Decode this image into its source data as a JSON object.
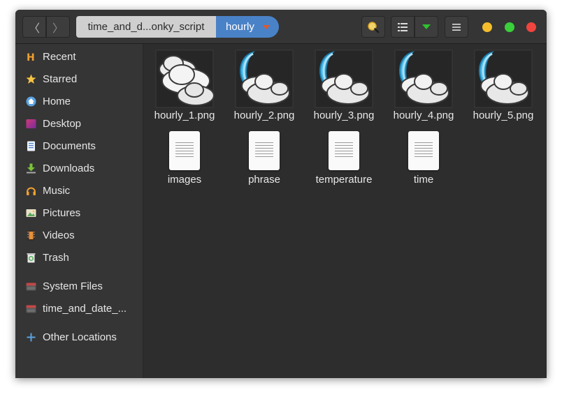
{
  "header": {
    "back_glyph": "〈",
    "forward_glyph": "〉",
    "breadcrumb_parent": "time_and_d...onky_script",
    "breadcrumb_current": "hourly"
  },
  "sidebar": {
    "items": [
      {
        "label": "Recent",
        "icon": "recent-icon"
      },
      {
        "label": "Starred",
        "icon": "star-icon"
      },
      {
        "label": "Home",
        "icon": "home-icon"
      },
      {
        "label": "Desktop",
        "icon": "desktop-icon"
      },
      {
        "label": "Documents",
        "icon": "documents-icon"
      },
      {
        "label": "Downloads",
        "icon": "downloads-icon"
      },
      {
        "label": "Music",
        "icon": "music-icon"
      },
      {
        "label": "Pictures",
        "icon": "pictures-icon"
      },
      {
        "label": "Videos",
        "icon": "videos-icon"
      },
      {
        "label": "Trash",
        "icon": "trash-icon"
      },
      {
        "label": "System Files",
        "icon": "drive-icon"
      },
      {
        "label": "time_and_date_...",
        "icon": "drive-icon"
      },
      {
        "label": "Other Locations",
        "icon": "plus-icon"
      }
    ]
  },
  "files": [
    {
      "name": "hourly_1.png",
      "kind": "cloudy-image"
    },
    {
      "name": "hourly_2.png",
      "kind": "moon-cloud-image"
    },
    {
      "name": "hourly_3.png",
      "kind": "moon-cloud-image"
    },
    {
      "name": "hourly_4.png",
      "kind": "moon-cloud-image"
    },
    {
      "name": "hourly_5.png",
      "kind": "moon-cloud-image"
    },
    {
      "name": "images",
      "kind": "text-document"
    },
    {
      "name": "phrase",
      "kind": "text-document"
    },
    {
      "name": "temperature",
      "kind": "text-document"
    },
    {
      "name": "time",
      "kind": "text-document"
    }
  ],
  "colors": {
    "accent": "#4a82c8",
    "window_bg": "#2d2d2d",
    "sidebar_bg": "#353535",
    "close": "#f0443f",
    "minimize": "#f5bd2b",
    "maximize": "#3ad03a"
  }
}
